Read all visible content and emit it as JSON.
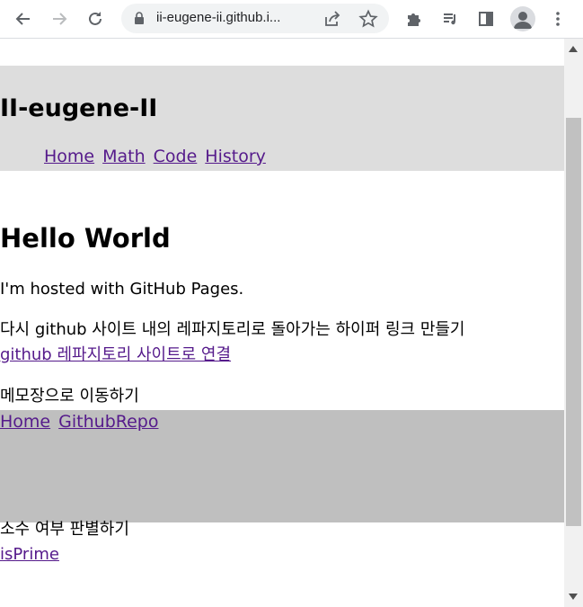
{
  "browser": {
    "url": "ii-eugene-ii.github.i...",
    "icons": [
      "back-arrow-icon",
      "forward-arrow-icon",
      "reload-icon",
      "lock-icon",
      "share-icon",
      "star-icon",
      "extensions-puzzle-icon",
      "reading-list-icon",
      "side-panel-icon",
      "profile-icon",
      "kebab-menu-icon"
    ]
  },
  "header": {
    "title": "II-eugene-II",
    "nav": [
      "Home",
      "Math",
      "Code",
      "History"
    ]
  },
  "main": {
    "heading": "Hello World",
    "hosted_text": "I'm hosted with GitHub Pages.",
    "repo_intro": "다시 github 사이트 내의 레파지토리로 돌아가는 하이퍼 링크 만들기",
    "repo_link": "github 레파지토리 사이트로 연결",
    "memo_text": "메모장으로 이동하기",
    "prime_text": "소수 여부 판별하기",
    "prime_link": "isPrime"
  },
  "overlay_nav": {
    "links": [
      "Home",
      "GithubRepo"
    ]
  },
  "colors": {
    "header_bg": "#dddddd",
    "overlay_bg": "#bfbfbf",
    "link": "#551a8b"
  }
}
